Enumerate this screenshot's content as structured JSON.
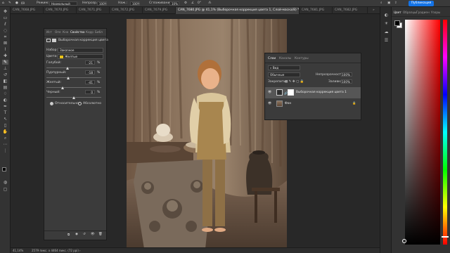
{
  "options_bar": {
    "mode_label": "Режим:",
    "mode_value": "Нормальный",
    "opacity_label": "Непрозр.:",
    "opacity_value": "100%",
    "pressure_label": "Наж.:",
    "pressure_value": "100%",
    "smoothing_label": "Сглаживание:",
    "smoothing_value": "10%",
    "angle_value": "0°",
    "publish_label": "Публикация"
  },
  "tabs": [
    {
      "label": "CAN_7668.JPG"
    },
    {
      "label": "CAN_7670.JPG"
    },
    {
      "label": "CAN_7671.JPG"
    },
    {
      "label": "CAN_7672.JPG"
    },
    {
      "label": "CAN_7679.JPG"
    },
    {
      "label": "CAN_7680.JPG @ 41,1% (Выборочная коррекция цвета 1, Слой-маска/8) *"
    },
    {
      "label": "CAN_7681.JPG"
    },
    {
      "label": "CAN_7682.JPG"
    }
  ],
  "properties": {
    "tabs": [
      "Ист",
      "Опе",
      "Кно",
      "Свойства",
      "Корр",
      "Библ"
    ],
    "adjustment_title": "Выборочная коррекция цвета",
    "preset_label": "Набор:",
    "preset_value": "Заказное",
    "colors_label": "Цвета:",
    "colors_value": "Желтые",
    "rows": [
      {
        "label": "Голубой:",
        "value": "-21",
        "unit": "%",
        "level": 0.395
      },
      {
        "label": "Пурпурный:",
        "value": "-18",
        "unit": "%",
        "level": 0.41
      },
      {
        "label": "Желтый:",
        "value": "-41",
        "unit": "%",
        "level": 0.295
      },
      {
        "label": "Черный:",
        "value": "0",
        "unit": "%",
        "level": 0.5
      }
    ],
    "relative_label": "Относительно",
    "absolute_label": "Абсолютно"
  },
  "layers": {
    "tabs": [
      "Слои",
      "Каналы",
      "Контуры"
    ],
    "filter_value": "Вид",
    "blend_mode": "Обычные",
    "opacity_label": "Непрозрачность:",
    "opacity_value": "100%",
    "lock_label": "Закрепить:",
    "fill_label": "Заливка:",
    "fill_value": "100%",
    "items": [
      {
        "name": "Выборочная коррекция цвета 1"
      },
      {
        "name": "Фон"
      }
    ]
  },
  "color_panel": {
    "tabs": [
      "Цвет",
      "Образцы",
      "Градиен",
      "Узоры"
    ],
    "hue_marker": 0.97
  },
  "status": {
    "zoom": "41,14%",
    "doc_info": "2579 пикс. x 4464 пикс. (72 ppi)"
  },
  "colors": {
    "accent": "#1473e6",
    "panel_bg": "#3b3b3b",
    "swatch_yellow": "#e8c21a",
    "foreground": "#000000",
    "background": "#ffffff"
  }
}
